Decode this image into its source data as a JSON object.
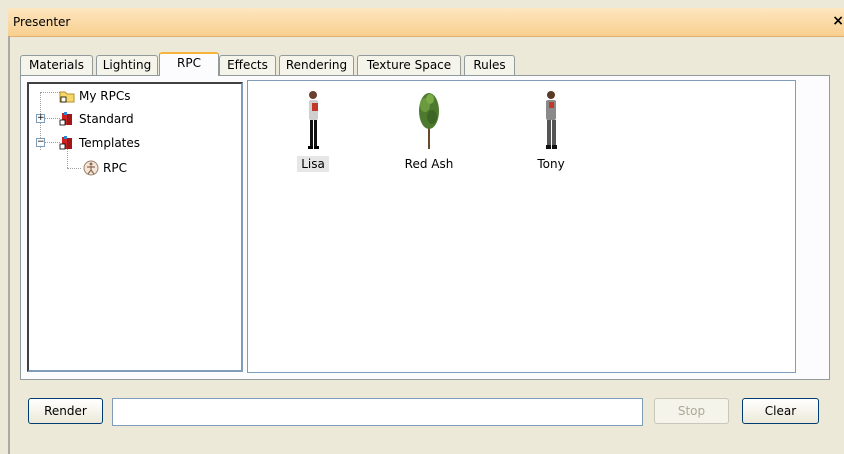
{
  "window": {
    "title": "Presenter",
    "close_glyph": "×"
  },
  "tabs": [
    {
      "label": "Materials"
    },
    {
      "label": "Lighting"
    },
    {
      "label": "RPC"
    },
    {
      "label": "Effects"
    },
    {
      "label": "Rendering"
    },
    {
      "label": "Texture Space"
    },
    {
      "label": "Rules"
    }
  ],
  "active_tab": "RPC",
  "tree": {
    "items": [
      {
        "label": "My RPCs",
        "icon": "folder-icon"
      },
      {
        "label": "Standard",
        "icon": "library-books-icon",
        "expander": "+"
      },
      {
        "label": "Templates",
        "icon": "library-books-icon",
        "expander": "−"
      },
      {
        "label": "RPC",
        "icon": "human-figure-icon"
      }
    ]
  },
  "rpc_items": [
    {
      "label": "Lisa",
      "icon": "person-icon",
      "selected": true
    },
    {
      "label": "Red Ash",
      "icon": "tree-icon",
      "selected": false
    },
    {
      "label": "Tony",
      "icon": "person-icon",
      "selected": false
    }
  ],
  "bottom": {
    "render_label": "Render",
    "input_value": "",
    "stop_label": "Stop",
    "clear_label": "Clear"
  },
  "colors": {
    "titlebar": "#f8cf8f",
    "active_tab_accent": "#f8b33c",
    "window_bg": "#ece9d8"
  }
}
